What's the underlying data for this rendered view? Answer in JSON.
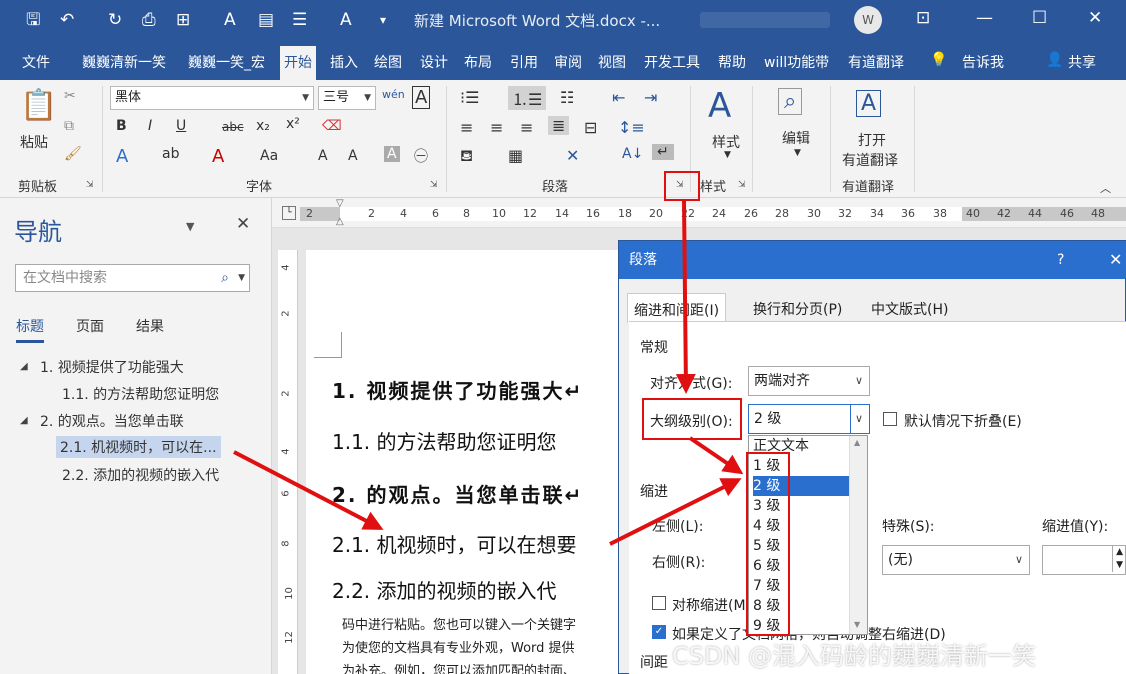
{
  "window": {
    "title": "新建 Microsoft Word 文档.docx  -...",
    "avatar": "W"
  },
  "ribbon_tabs": [
    "文件",
    "巍巍清新一笑",
    "巍巍一笑_宏",
    "开始",
    "插入",
    "绘图",
    "设计",
    "布局",
    "引用",
    "审阅",
    "视图",
    "开发工具",
    "帮助",
    "will功能带",
    "有道翻译"
  ],
  "tell_me": "告诉我",
  "share": "共享",
  "ribbon": {
    "clipboard": {
      "paste": "粘贴",
      "group": "剪贴板"
    },
    "font": {
      "name": "黑体",
      "size": "三号",
      "group": "字体"
    },
    "paragraph": {
      "group": "段落"
    },
    "styles": {
      "button": "样式",
      "group": "样式"
    },
    "editing": {
      "button": "编辑"
    },
    "youdao": {
      "button_line1": "打开",
      "button_line2": "有道翻译",
      "group": "有道翻译"
    }
  },
  "ruler_ticks": [
    "2",
    "2",
    "4",
    "6",
    "8",
    "10",
    "12",
    "14",
    "16",
    "18",
    "20",
    "22",
    "24",
    "26",
    "28",
    "30",
    "32",
    "34",
    "36",
    "38",
    "40",
    "42",
    "44",
    "46",
    "48"
  ],
  "vruler_ticks": [
    "4",
    "2",
    "2",
    "4",
    "6",
    "8",
    "10",
    "12"
  ],
  "nav": {
    "title": "导航",
    "search_placeholder": "在文档中搜索",
    "tabs": [
      "标题",
      "页面",
      "结果"
    ],
    "tree": [
      {
        "label": "1. 视频提供了功能强大"
      },
      {
        "label": "1.1. 的方法帮助您证明您"
      },
      {
        "label": "2. 的观点。当您单击联"
      },
      {
        "label": "2.1. 机视频时，可以在..."
      },
      {
        "label": "2.2. 添加的视频的嵌入代"
      }
    ]
  },
  "document": {
    "headings": [
      "1. 视频提供了功能强大↵",
      "1.1. 的方法帮助您证明您",
      "2. 的观点。当您单击联↵",
      "2.1. 机视频时，可以在想要",
      "2.2. 添加的视频的嵌入代"
    ],
    "body": [
      "码中进行粘贴。您也可以键入一个关键字",
      "为使您的文档具有专业外观，Word 提供",
      "为补充。例如，您可以添加匹配的封面、"
    ]
  },
  "dialog": {
    "title": "段落",
    "help": "?",
    "close": "✕",
    "tabs": [
      "缩进和间距(I)",
      "换行和分页(P)",
      "中文版式(H)"
    ],
    "section_general": "常规",
    "align_label": "对齐方式(G):",
    "align_value": "两端对齐",
    "outline_label": "大纲级别(O):",
    "outline_value": "2 级",
    "collapse_label": "默认情况下折叠(E)",
    "section_indent": "缩进",
    "left_label": "左侧(L):",
    "right_label": "右侧(R):",
    "special_label": "特殊(S):",
    "special_value": "(无)",
    "indent_value_label": "缩进值(Y):",
    "mirror_label": "对称缩进(M)",
    "auto_adjust_label": "如果定义了文档网格，则自动调整右缩进(D)",
    "section_spacing": "间距",
    "outline_options": [
      "正文文本",
      "1 级",
      "2 级",
      "3 级",
      "4 级",
      "5 级",
      "6 级",
      "7 级",
      "8 级",
      "9 级"
    ],
    "selected_option": "2 级"
  },
  "watermark": "CSDN @混入码龄的巍巍清新一笑",
  "colors": {
    "brand": "#2b579a",
    "dialog_title": "#2b6fce",
    "annotation": "#e01010"
  }
}
